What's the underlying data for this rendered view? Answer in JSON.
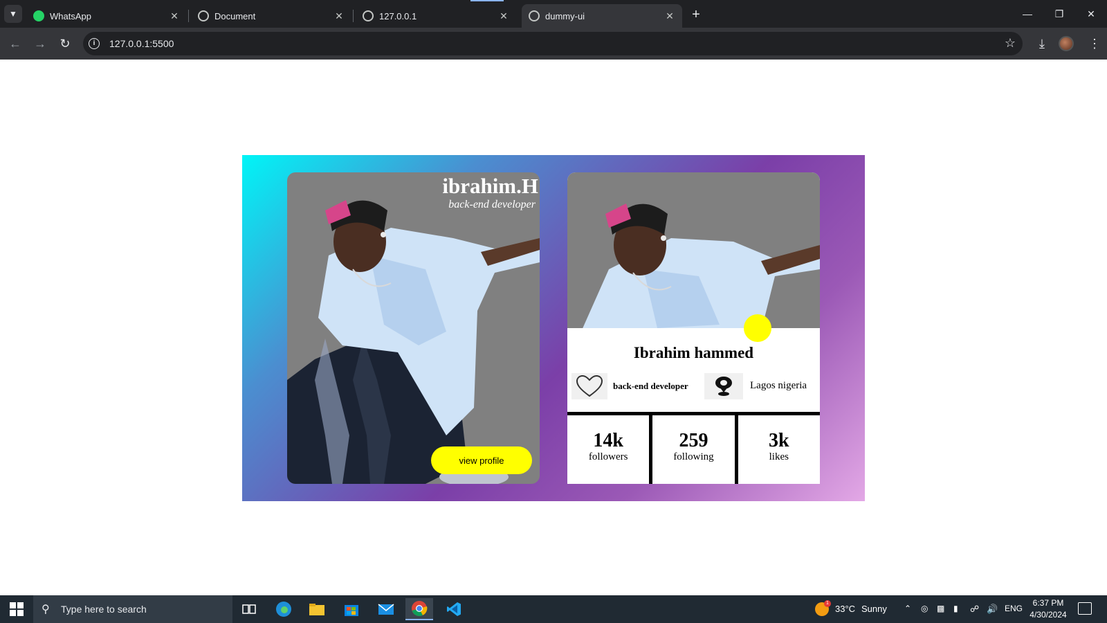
{
  "browser": {
    "tabs": [
      {
        "title": "WhatsApp",
        "icon": "whatsapp-icon"
      },
      {
        "title": "Document",
        "icon": "globe-icon"
      },
      {
        "title": "127.0.0.1",
        "icon": "globe-icon"
      },
      {
        "title": "dummy-ui",
        "icon": "globe-icon",
        "active": true
      }
    ],
    "url": "127.0.0.1:5500"
  },
  "left_card": {
    "name": "ibrahim.H",
    "role": "back-end developer",
    "button_label": "view profile"
  },
  "right_card": {
    "name": "Ibrahim hammed",
    "role": "back-end developer",
    "location": "Lagos nigeria",
    "stats": [
      {
        "value": "14k",
        "label": "followers"
      },
      {
        "value": "259",
        "label": "following"
      },
      {
        "value": "3k",
        "label": "likes"
      }
    ]
  },
  "taskbar": {
    "search_placeholder": "Type here to search",
    "weather_temp": "33°C",
    "weather_desc": "Sunny",
    "weather_badge": "1",
    "language": "ENG",
    "time": "6:37 PM",
    "date": "4/30/2024"
  },
  "colors": {
    "accent_yellow": "#ffff00",
    "photo_bg": "#808080",
    "gradient_start": "#00f5f7",
    "gradient_end": "#e3a8e6"
  }
}
